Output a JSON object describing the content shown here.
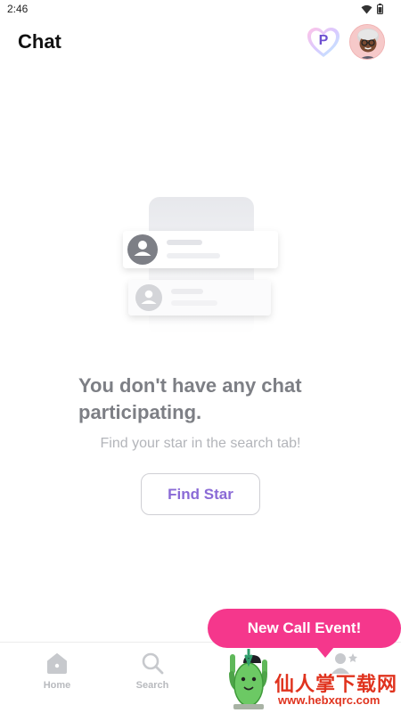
{
  "status_bar": {
    "time": "2:46",
    "icons": [
      "wifi-icon",
      "battery-icon"
    ]
  },
  "header": {
    "title": "Chat",
    "premium_badge_letter": "P"
  },
  "empty_state": {
    "title": "You don't have any chat participating.",
    "subtitle": "Find your star in the search tab!",
    "button_label": "Find Star"
  },
  "bottom_nav": {
    "items": [
      {
        "label": "Home",
        "icon": "home-icon"
      },
      {
        "label": "Search",
        "icon": "search-icon"
      }
    ]
  },
  "event_bubble": {
    "label": "New Call Event!"
  },
  "watermark": {
    "text_cn": "仙人掌下载网",
    "url": "www.hebxqrc.com"
  },
  "colors": {
    "accent_purple": "#8a6ad6",
    "event_pink": "#f5378c",
    "watermark_red": "#e0331e"
  }
}
